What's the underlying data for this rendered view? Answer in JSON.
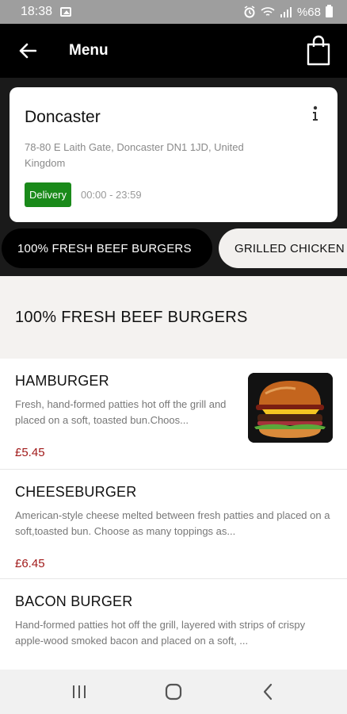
{
  "status_bar": {
    "time": "18:38",
    "battery": "%68",
    "icons": [
      "image-icon",
      "alarm-icon",
      "wifi-icon",
      "signal-icon",
      "battery-icon"
    ]
  },
  "header": {
    "title": "Menu",
    "back_icon": "arrow-left-icon",
    "cart_icon": "shopping-bag-icon"
  },
  "store": {
    "name": "Doncaster",
    "address": "78-80 E Laith Gate, Doncaster DN1 1JD, United Kingdom",
    "badge": "Delivery",
    "hours": "00:00 - 23:59",
    "badge_color": "#1a8a1a"
  },
  "tabs": [
    {
      "label": "100% FRESH BEEF BURGERS",
      "active": true
    },
    {
      "label": "GRILLED CHICKEN",
      "active": false
    }
  ],
  "section": {
    "title": "100% FRESH BEEF BURGERS"
  },
  "items": [
    {
      "name": "HAMBURGER",
      "description": "Fresh, hand-formed patties hot off the grill and placed on a soft, toasted bun.Choos...",
      "price": "£5.45",
      "image": "burger-photo"
    },
    {
      "name": "CHEESEBURGER",
      "description": "American-style cheese melted between fresh patties and placed on a soft,toasted bun. Choose as many toppings as...",
      "price": "£6.45"
    },
    {
      "name": "BACON BURGER",
      "description": "Hand-formed patties hot off the grill, layered with strips of crispy apple-wood smoked bacon and placed on a soft, ..."
    }
  ],
  "price_color": "#a11a1a",
  "nav_bar": {
    "icons": [
      "recents-icon",
      "home-icon",
      "back-icon"
    ]
  }
}
